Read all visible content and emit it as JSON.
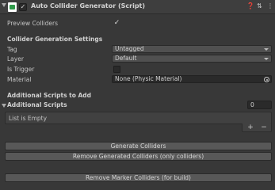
{
  "component": {
    "title": "Auto Collider Generator (Script)",
    "icons": [
      "help-icon",
      "preset-icon",
      "more-icon"
    ]
  },
  "preview": {
    "label": "Preview Colliders",
    "checked": true
  },
  "collider_section": {
    "title": "Collider Generation Settings",
    "tag": {
      "label": "Tag",
      "value": "Untagged"
    },
    "layer": {
      "label": "Layer",
      "value": "Default"
    },
    "is_trigger": {
      "label": "Is Trigger",
      "checked": false
    },
    "material": {
      "label": "Material",
      "value": "None (Physic Material)"
    }
  },
  "scripts_section": {
    "title": "Additional Scripts to Add",
    "list_label": "Additional Scripts",
    "count": "0",
    "empty_text": "List is Empty",
    "add_label": "+",
    "remove_label": "−"
  },
  "buttons": {
    "generate": "Generate Colliders",
    "remove_generated": "Remove Generated Colliders (only colliders)",
    "remove_marker": "Remove Marker Colliders (for build)"
  }
}
